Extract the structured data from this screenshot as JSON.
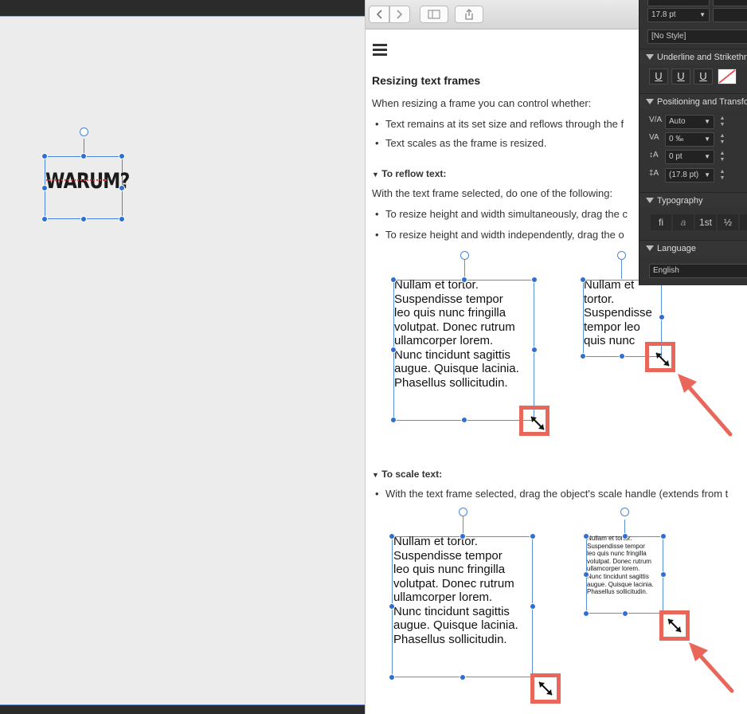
{
  "canvas": {
    "art_text": "WARUM?"
  },
  "help": {
    "title": "Resizing text frames",
    "intro": "When resizing a frame you can control whether:",
    "bullets": [
      "Text remains at its set size and reflows through the f",
      "Text scales as the frame is resized."
    ],
    "reflow_heading": "To reflow text:",
    "reflow_intro": "With the text frame selected, do one of the following:",
    "reflow_bullets": [
      "To resize height and width simultaneously, drag the c",
      "To resize height and width independently, drag the o"
    ],
    "scale_heading": "To scale text:",
    "scale_bullet": "With the text frame selected, drag the object's scale handle (extends from t",
    "sample_text_large": [
      "Nullam et tortor.",
      "Suspendisse tempor",
      "leo quis nunc fringilla",
      "volutpat. Donec rutrum",
      "ullamcorper lorem.",
      "Nunc tincidunt sagittis",
      "augue. Quisque lacinia.",
      "Phasellus sollicitudin."
    ],
    "sample_text_reflow_small": [
      "Nullam et",
      "tortor.",
      "Suspendisse",
      "tempor leo",
      "quis nunc"
    ],
    "sample_text_scaled_small": [
      "Nullam et tortor.",
      "Suspendisse tempor",
      "leo quis nunc fringilla",
      "volutpat. Donec rutrum",
      "ullamcorper lorem.",
      "Nunc tincidunt sagittis",
      "augue. Quisque lacinia.",
      "Phasellus sollicitudin."
    ]
  },
  "panel": {
    "font_size": "17.8 pt",
    "style": "[No Style]",
    "underline_header": "Underline and Strikethr",
    "positioning_header": "Positioning and Transfo",
    "tracking": "Auto",
    "kerning": "0 ‰",
    "baseline": "0 pt",
    "leading": "(17.8 pt)",
    "typography_header": "Typography",
    "typography_buttons": [
      "fi",
      "a",
      "1st",
      "½",
      "S"
    ],
    "language_header": "Language",
    "language": "English"
  },
  "colors": {
    "accent": "#2f6fd1",
    "callout": "#e8675a",
    "panel_bg": "#333333"
  }
}
